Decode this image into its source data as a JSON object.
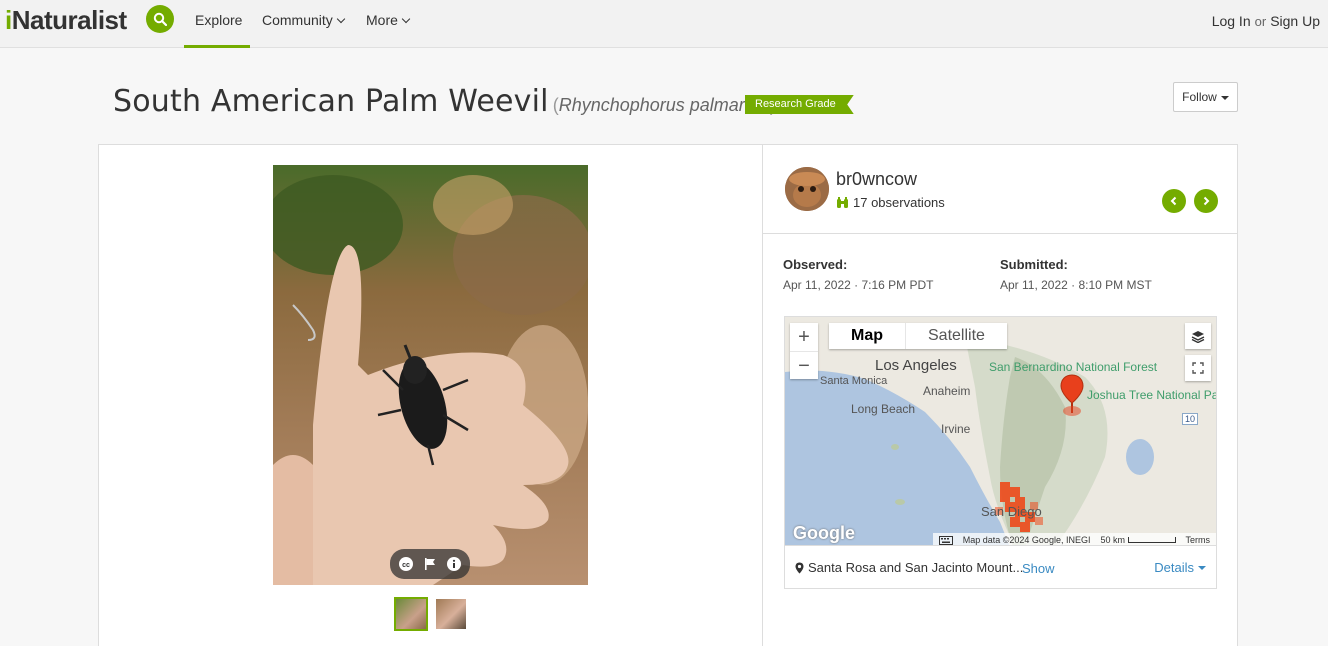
{
  "header": {
    "logo_prefix": "i",
    "logo_rest": "Naturalist",
    "nav": {
      "explore": "Explore",
      "community": "Community",
      "more": "More"
    },
    "login": "Log In",
    "or": "or",
    "signup": "Sign Up"
  },
  "observation": {
    "common_name": "South American Palm Weevil",
    "scientific_name": "Rhynchophorus palmarum",
    "quality_grade": "Research Grade",
    "follow_label": "Follow"
  },
  "user": {
    "name": "br0wncow",
    "observations": "17 observations"
  },
  "dates": {
    "observed_label": "Observed:",
    "observed_value": "Apr 11, 2022 · 7:16 PM PDT",
    "submitted_label": "Submitted:",
    "submitted_value": "Apr 11, 2022 · 8:10 PM MST"
  },
  "map": {
    "type_map": "Map",
    "type_satellite": "Satellite",
    "zoom_in": "+",
    "zoom_out": "−",
    "labels": {
      "los_angeles": "Los Angeles",
      "santa_monica": "Santa Monica",
      "anaheim": "Anaheim",
      "long_beach": "Long Beach",
      "irvine": "Irvine",
      "san_bernardino_nf": "San Bernardino National Forest",
      "joshua_tree": "Joshua Tree National Park",
      "san_diego": "San Diego",
      "route_10": "10"
    },
    "google": "Google",
    "attribution": "Map data ©2024 Google, INEGI",
    "scale": "50 km",
    "terms": "Terms"
  },
  "place": {
    "name": "Santa Rosa and San Jacinto Mount...",
    "show": "Show",
    "details": "Details"
  },
  "colors": {
    "accent": "#74ac00",
    "link": "#3a8ac2",
    "marker": "#e8401c"
  }
}
